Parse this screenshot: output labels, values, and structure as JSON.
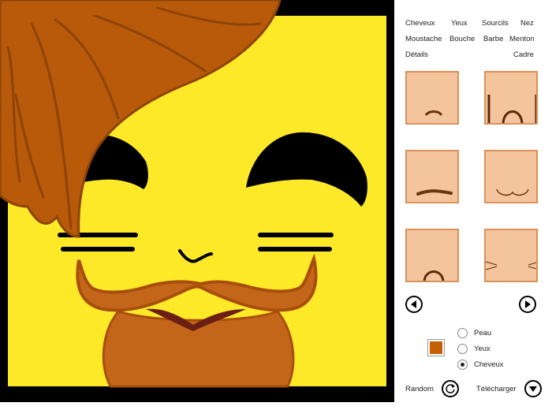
{
  "menu": {
    "items": [
      "Cheveux",
      "Yeux",
      "Sourcils",
      "Nez",
      "Moustache",
      "Bouche",
      "Barbe",
      "Menton",
      "Détails",
      "Cadre"
    ]
  },
  "thumbnails": [
    {
      "name": "chin-option-1"
    },
    {
      "name": "chin-option-2"
    },
    {
      "name": "chin-option-3"
    },
    {
      "name": "chin-option-4"
    },
    {
      "name": "chin-option-5"
    },
    {
      "name": "chin-option-6"
    }
  ],
  "navigation": {
    "prev_icon": "arrow-left-icon",
    "next_icon": "arrow-right-icon"
  },
  "color_target": {
    "options": [
      "Peau",
      "Yeux",
      "Cheveux"
    ],
    "selected": "Cheveux"
  },
  "colors": {
    "swatch": "#c45f05",
    "face": "#fde928",
    "hair": "#b85a0a",
    "beard": "#c4661a",
    "lips": "#6b1e14",
    "skin_thumb": "#f4c49c"
  },
  "actions": {
    "random_label": "Random",
    "download_label": "Télécharger",
    "random_icon": "refresh-icon",
    "download_icon": "download-icon"
  }
}
